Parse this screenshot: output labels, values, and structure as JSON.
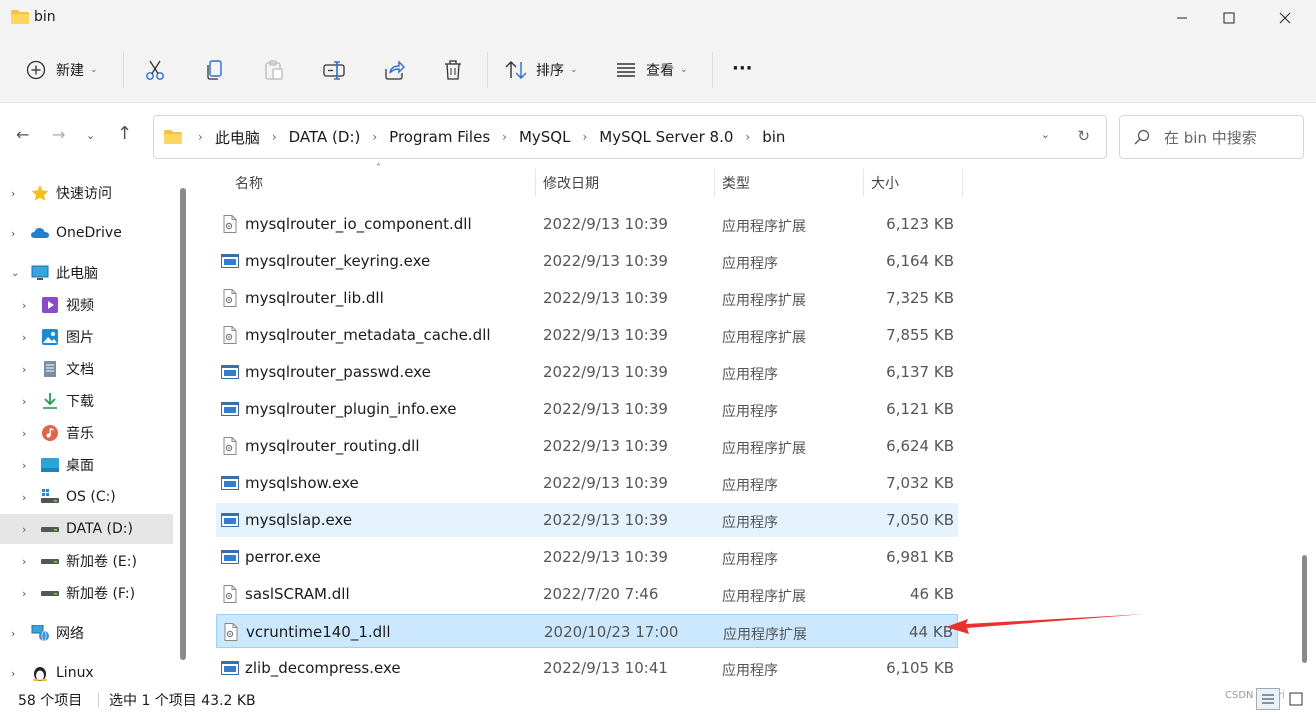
{
  "window": {
    "title": "bin",
    "icons": [
      "folder-icon"
    ]
  },
  "toolbar": {
    "new_label": "新建",
    "sort_label": "排序",
    "view_label": "查看",
    "more_label": "···"
  },
  "address": {
    "crumbs": [
      "此电脑",
      "DATA (D:)",
      "Program Files",
      "MySQL",
      "MySQL Server 8.0",
      "bin"
    ],
    "search_placeholder": "在 bin 中搜索"
  },
  "sidebar": {
    "items": [
      {
        "label": "快速访问",
        "icon": "star-icon"
      },
      {
        "label": "OneDrive",
        "icon": "cloud-icon"
      },
      {
        "label": "此电脑",
        "icon": "monitor-icon"
      },
      {
        "label": "视频",
        "icon": "video-icon"
      },
      {
        "label": "图片",
        "icon": "picture-icon"
      },
      {
        "label": "文档",
        "icon": "document-icon"
      },
      {
        "label": "下载",
        "icon": "download-icon"
      },
      {
        "label": "音乐",
        "icon": "music-icon"
      },
      {
        "label": "桌面",
        "icon": "desktop-icon"
      },
      {
        "label": "OS (C:)",
        "icon": "drive-icon"
      },
      {
        "label": "DATA (D:)",
        "icon": "drive-icon"
      },
      {
        "label": "新加卷 (E:)",
        "icon": "drive-icon"
      },
      {
        "label": "新加卷 (F:)",
        "icon": "drive-icon"
      },
      {
        "label": "网络",
        "icon": "network-icon"
      },
      {
        "label": "Linux",
        "icon": "linux-icon"
      }
    ]
  },
  "columns": {
    "name": "名称",
    "date": "修改日期",
    "type": "类型",
    "size": "大小"
  },
  "files": [
    {
      "name": "mysqlrouter_io_component.dll",
      "date": "2022/9/13 10:39",
      "type": "应用程序扩展",
      "size": "6,123 KB",
      "kind": "dll"
    },
    {
      "name": "mysqlrouter_keyring.exe",
      "date": "2022/9/13 10:39",
      "type": "应用程序",
      "size": "6,164 KB",
      "kind": "exe"
    },
    {
      "name": "mysqlrouter_lib.dll",
      "date": "2022/9/13 10:39",
      "type": "应用程序扩展",
      "size": "7,325 KB",
      "kind": "dll"
    },
    {
      "name": "mysqlrouter_metadata_cache.dll",
      "date": "2022/9/13 10:39",
      "type": "应用程序扩展",
      "size": "7,855 KB",
      "kind": "dll"
    },
    {
      "name": "mysqlrouter_passwd.exe",
      "date": "2022/9/13 10:39",
      "type": "应用程序",
      "size": "6,137 KB",
      "kind": "exe"
    },
    {
      "name": "mysqlrouter_plugin_info.exe",
      "date": "2022/9/13 10:39",
      "type": "应用程序",
      "size": "6,121 KB",
      "kind": "exe"
    },
    {
      "name": "mysqlrouter_routing.dll",
      "date": "2022/9/13 10:39",
      "type": "应用程序扩展",
      "size": "6,624 KB",
      "kind": "dll"
    },
    {
      "name": "mysqlshow.exe",
      "date": "2022/9/13 10:39",
      "type": "应用程序",
      "size": "7,032 KB",
      "kind": "exe"
    },
    {
      "name": "mysqlslap.exe",
      "date": "2022/9/13 10:39",
      "type": "应用程序",
      "size": "7,050 KB",
      "kind": "exe"
    },
    {
      "name": "perror.exe",
      "date": "2022/9/13 10:39",
      "type": "应用程序",
      "size": "6,981 KB",
      "kind": "exe"
    },
    {
      "name": "saslSCRAM.dll",
      "date": "2022/7/20 7:46",
      "type": "应用程序扩展",
      "size": "46 KB",
      "kind": "dll"
    },
    {
      "name": "vcruntime140_1.dll",
      "date": "2020/10/23 17:00",
      "type": "应用程序扩展",
      "size": "44 KB",
      "kind": "dll"
    },
    {
      "name": "zlib_decompress.exe",
      "date": "2022/9/13 10:41",
      "type": "应用程序",
      "size": "6,105 KB",
      "kind": "exe"
    }
  ],
  "status": {
    "count": "58 个项目",
    "selected": "选中 1 个项目  43.2 KB",
    "watermark": "CSDN @Furi"
  },
  "colors": {
    "accent": "#0067c0",
    "selected_row": "#cce8ff",
    "hover_row": "#e5f3ff",
    "annotation_arrow": "#e8322f"
  }
}
